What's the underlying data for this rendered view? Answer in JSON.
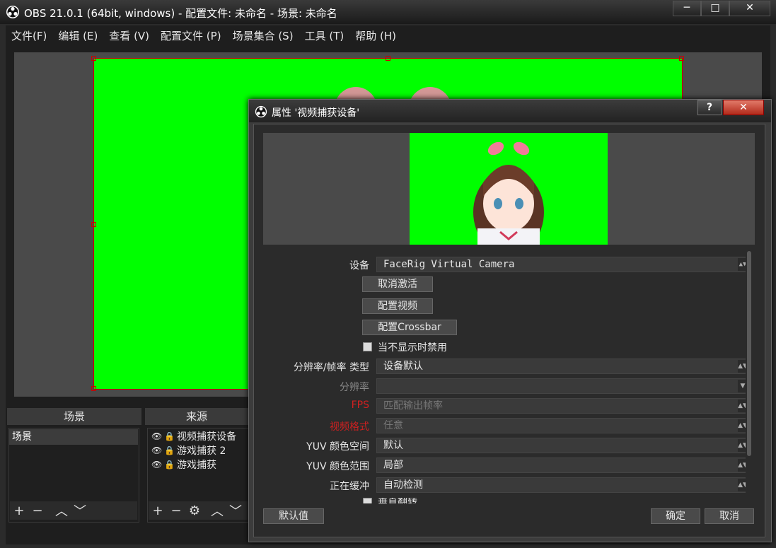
{
  "window": {
    "title": "OBS 21.0.1 (64bit, windows) - 配置文件: 未命名 - 场景: 未命名",
    "minimize": "─",
    "maximize": "□",
    "close": "✕"
  },
  "menu": [
    "文件(F)",
    "编辑 (E)",
    "查看 (V)",
    "配置文件 (P)",
    "场景集合 (S)",
    "工具 (T)",
    "帮助 (H)"
  ],
  "docks": {
    "scenes_header": "场景",
    "sources_header": "来源",
    "scenes": [
      "场景"
    ],
    "sources": [
      "视频捕获设备",
      "游戏捕获 2",
      "游戏捕获"
    ]
  },
  "dialog": {
    "title": "属性 '视频捕获设备'",
    "help": "?",
    "close": "✕",
    "device_label": "设备",
    "device_value": "FaceRig Virtual Camera",
    "deactivate_btn": "取消激活",
    "config_video_btn": "配置视频",
    "config_crossbar_btn": "配置Crossbar",
    "disable_hidden_label": "当不显示时禁用",
    "disable_hidden_checked": false,
    "res_type_label": "分辨率/帧率 类型",
    "res_type_value": "设备默认",
    "resolution_label": "分辨率",
    "resolution_value": "",
    "fps_label": "FPS",
    "fps_value": "匹配输出帧率",
    "video_format_label": "视频格式",
    "video_format_value": "任意",
    "yuv_space_label": "YUV 颜色空间",
    "yuv_space_value": "默认",
    "yuv_range_label": "YUV 颜色范围",
    "yuv_range_value": "局部",
    "buffering_label": "正在缓冲",
    "buffering_value": "自动检测",
    "flip_label": "垂直翻转",
    "defaults_btn": "默认值",
    "ok_btn": "确定",
    "cancel_btn": "取消"
  }
}
